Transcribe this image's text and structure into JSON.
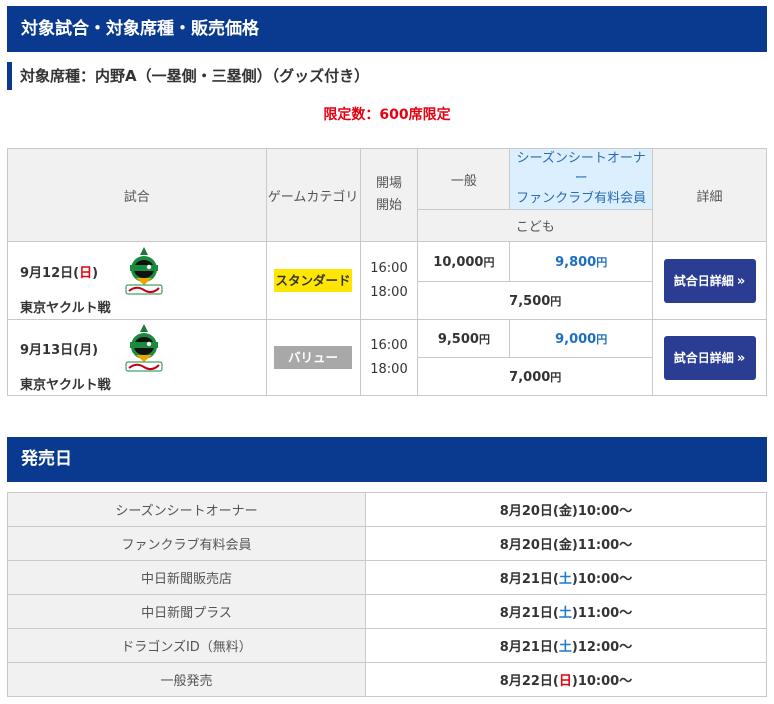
{
  "section1_title": "対象試合・対象席種・販売価格",
  "seat_type": "対象席種：内野A（一塁側・三塁側）（グッズ付き）",
  "limit": "限定数：600席限定",
  "table_headers": {
    "game": "試合",
    "category": "ゲームカテゴリ",
    "time_line1": "開場",
    "time_line2": "開始",
    "general": "一般",
    "sso_line1": "シーズンシートオーナー",
    "sso_line2": "ファンクラブ有料会員",
    "child": "こども",
    "detail": "詳細"
  },
  "games": [
    {
      "date_prefix": "9月12日(",
      "day": "日",
      "date_suffix": ")",
      "opponent": "東京ヤクルト戦",
      "category": "スタンダード",
      "open": "16:00",
      "start": "18:00",
      "general": "10,000",
      "member": "9,800",
      "child": "7,500",
      "yen": "円",
      "button": "試合日詳細",
      "button_arrow": "»"
    },
    {
      "date_prefix": "9月13日(",
      "day": "月",
      "date_suffix": ")",
      "opponent": "東京ヤクルト戦",
      "category": "バリュー",
      "open": "16:00",
      "start": "18:00",
      "general": "9,500",
      "member": "9,000",
      "child": "7,000",
      "yen": "円",
      "button": "試合日詳細",
      "button_arrow": "»"
    }
  ],
  "logo_icon": "swallows-logo-icon",
  "section2_title": "発売日",
  "sales": [
    {
      "label": "シーズンシートオーナー",
      "pre": "8月20日(",
      "day": "金",
      "post": ")10:00～"
    },
    {
      "label": "ファンクラブ有料会員",
      "pre": "8月20日(",
      "day": "金",
      "post": ")11:00～"
    },
    {
      "label": "中日新聞販売店",
      "pre": "8月21日(",
      "day": "土",
      "post": ")10:00～"
    },
    {
      "label": "中日新聞プラス",
      "pre": "8月21日(",
      "day": "土",
      "post": ")11:00～"
    },
    {
      "label": "ドラゴンズID（無料）",
      "pre": "8月21日(",
      "day": "土",
      "post": ")12:00～"
    },
    {
      "label": "一般発売",
      "pre": "8月22日(",
      "day": "日",
      "post": ")10:00～"
    }
  ],
  "colors": {
    "header": "#0a3a8f",
    "red": "#e60012",
    "blue": "#1e6fc0",
    "button": "#2a3d93",
    "standard": "#ffe600",
    "value": "#a8a8a8"
  }
}
